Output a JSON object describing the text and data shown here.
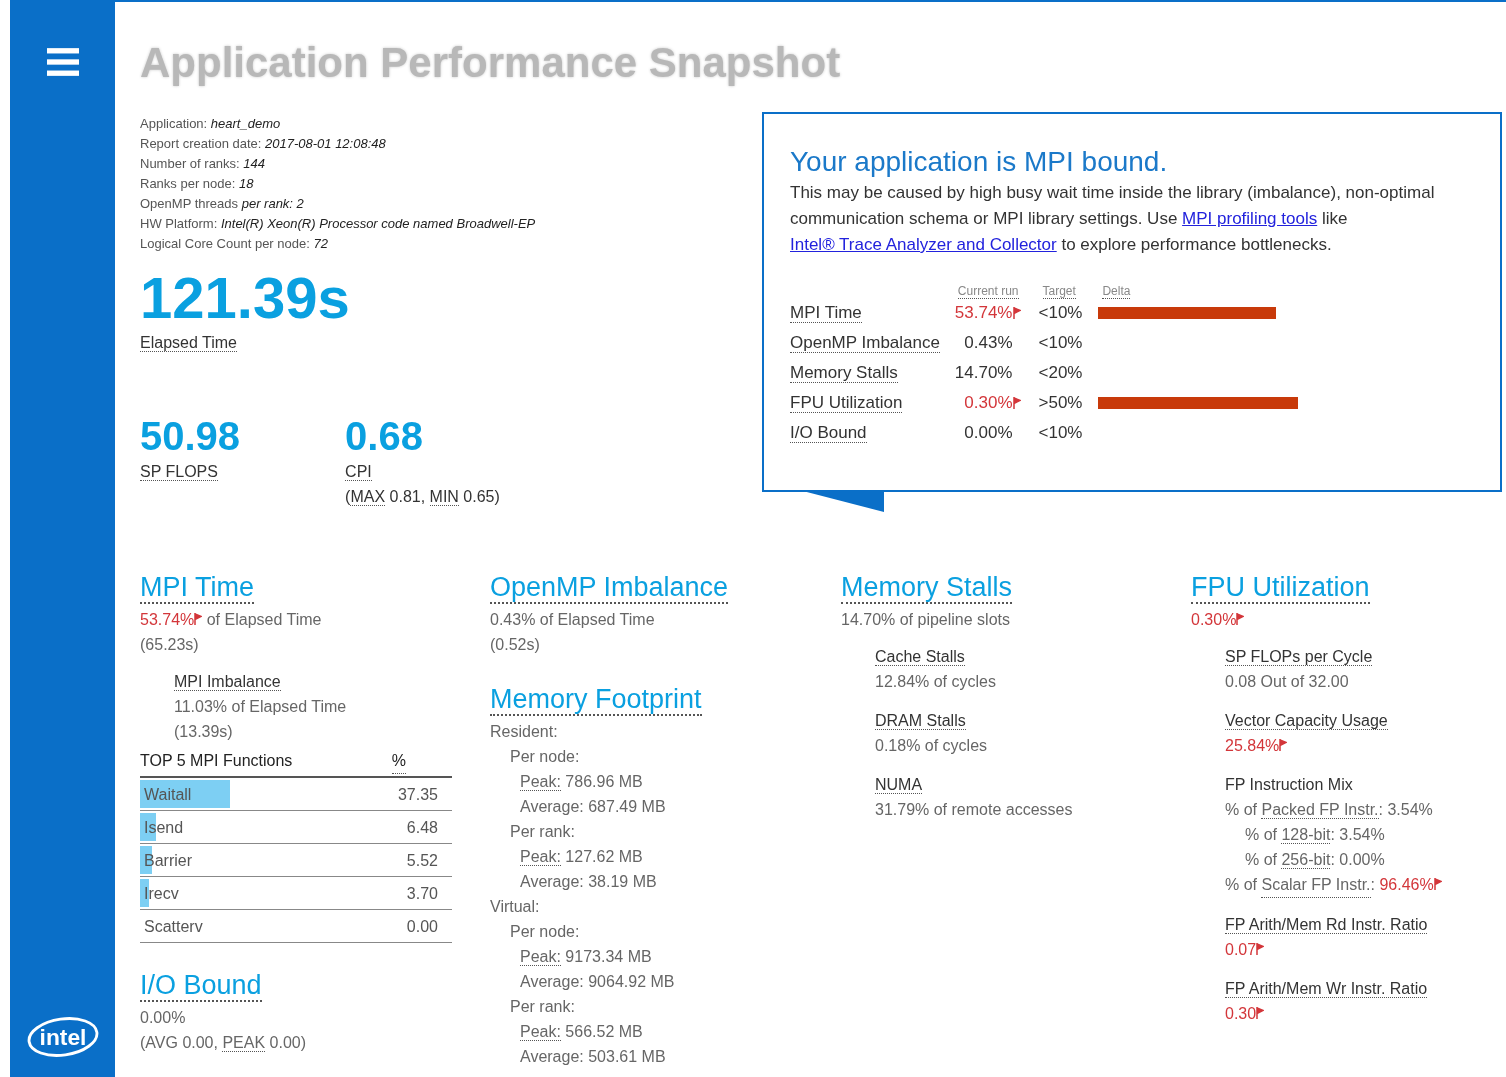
{
  "sidebar": {
    "logo": "intel"
  },
  "title": "Application Performance Snapshot",
  "info": [
    {
      "label": "Application:",
      "value": "heart_demo"
    },
    {
      "label": "Report creation date:",
      "value": "2017-08-01 12:08:48"
    },
    {
      "label": "Number of ranks:",
      "value": "144"
    },
    {
      "label": "Ranks per node:",
      "value": "18"
    },
    {
      "label": "OpenMP threads",
      "value": "per rank: 2"
    },
    {
      "label": "HW Platform:",
      "value": "Intel(R) Xeon(R) Processor code named Broadwell-EP"
    },
    {
      "label": "Logical Core Count per node:",
      "value": "72"
    }
  ],
  "elapsed": {
    "value": "121.39s",
    "label": "Elapsed Time"
  },
  "metrics": [
    {
      "value": "50.98",
      "label": "SP FLOPS"
    },
    {
      "value": "0.68",
      "label": "CPI",
      "detail": [
        {
          "text": "("
        },
        {
          "text": "MAX",
          "term": true
        },
        {
          "text": " 0.81, "
        },
        {
          "text": "MIN",
          "term": true
        },
        {
          "text": " 0.65)"
        }
      ]
    }
  ],
  "callout": {
    "title": "Your application is MPI bound.",
    "body": [
      {
        "text": "This may be caused by high busy wait time inside the library (imbalance), non-optimal communication schema or MPI library settings. Use "
      },
      {
        "text": "MPI profiling tools",
        "link": true
      },
      {
        "text": " like "
      },
      {
        "text": "Intel® Trace Analyzer and Collector",
        "link": true
      },
      {
        "text": " to explore performance bottlenecks."
      }
    ],
    "columns": [
      "Current run",
      "Target",
      "Delta"
    ],
    "rows": [
      {
        "name": "MPI Time",
        "current": "53.74%",
        "flag": true,
        "target": "<10%",
        "level": 0.48
      },
      {
        "name": "OpenMP Imbalance",
        "current": "0.43%",
        "flag": false,
        "target": "<10%"
      },
      {
        "name": "Memory Stalls",
        "current": "14.70%",
        "flag": false,
        "target": "<20%"
      },
      {
        "name": "FPU Utilization",
        "current": "0.30%",
        "flag": true,
        "target": ">50%",
        "level": 0.54
      },
      {
        "name": "I/O Bound",
        "current": "0.00%",
        "flag": false,
        "target": "<10%"
      }
    ]
  },
  "columns": [
    [
      {
        "title": "MPI Time",
        "lines": [
          [
            {
              "text": "53.74%",
              "flag": true
            },
            {
              "text": " of Elapsed Time"
            }
          ],
          "(65.23s)"
        ],
        "subsections": [
          {
            "title": "MPI Imbalance",
            "term": true,
            "lines": [
              "11.03% of Elapsed Time",
              "(13.39s)"
            ]
          }
        ],
        "functions": {
          "columns": [
            "TOP 5 MPI Functions",
            "%"
          ],
          "rows": [
            {
              "name": "Waitall",
              "value": "37.35",
              "level": 0.29
            },
            {
              "name": "Isend",
              "value": "6.48",
              "level": 0.05
            },
            {
              "name": "Barrier",
              "value": "5.52",
              "level": 0.04
            },
            {
              "name": "Irecv",
              "value": "3.70",
              "level": 0.03
            },
            {
              "name": "Scatterv",
              "value": "0.00"
            }
          ]
        }
      },
      {
        "title": "I/O Bound",
        "lines": [
          "0.00%",
          [
            {
              "text": "(AVG 0.00, "
            },
            {
              "text": "PEAK",
              "term": true
            },
            {
              "text": " 0.00)"
            }
          ]
        ]
      }
    ],
    [
      {
        "title": "OpenMP Imbalance",
        "lines": [
          "0.43% of Elapsed Time",
          "(0.52s)"
        ]
      },
      {
        "title": "Memory Footprint",
        "tree": [
          {
            "text": "Resident:",
            "children": [
              {
                "text": "Per node:",
                "children": [
                  {
                    "parts": [
                      {
                        "text": "Peak:",
                        "term": true
                      },
                      {
                        "text": " 786.96 MB"
                      }
                    ]
                  },
                  {
                    "text": "Average: 687.49 MB"
                  }
                ]
              },
              {
                "text": "Per rank:",
                "children": [
                  {
                    "parts": [
                      {
                        "text": "Peak:",
                        "term": true
                      },
                      {
                        "text": " 127.62 MB"
                      }
                    ]
                  },
                  {
                    "text": "Average: 38.19 MB"
                  }
                ]
              }
            ]
          },
          {
            "text": "Virtual:",
            "children": [
              {
                "text": "Per node:",
                "children": [
                  {
                    "parts": [
                      {
                        "text": "Peak:",
                        "term": true
                      },
                      {
                        "text": " 9173.34 MB"
                      }
                    ]
                  },
                  {
                    "text": "Average: 9064.92 MB"
                  }
                ]
              },
              {
                "text": "Per rank:",
                "children": [
                  {
                    "parts": [
                      {
                        "text": "Peak:",
                        "term": true
                      },
                      {
                        "text": " 566.52 MB"
                      }
                    ]
                  },
                  {
                    "text": "Average: 503.61 MB"
                  }
                ]
              }
            ]
          }
        ]
      }
    ],
    [
      {
        "title": "Memory Stalls",
        "lines": [
          "14.70% of pipeline slots"
        ],
        "subsections": [
          {
            "title": "Cache Stalls",
            "term": true,
            "lines": [
              "12.84% of cycles"
            ]
          },
          {
            "title": "DRAM Stalls",
            "term": true,
            "lines": [
              "0.18% of cycles"
            ]
          },
          {
            "title": "NUMA",
            "term": true,
            "lines": [
              "31.79% of remote accesses"
            ]
          }
        ]
      }
    ],
    [
      {
        "title": "FPU Utilization",
        "lines": [
          [
            {
              "text": "0.30%",
              "flag": true
            }
          ]
        ],
        "subsections": [
          {
            "title": "SP FLOPs per Cycle",
            "term": true,
            "lines": [
              "0.08 Out of 32.00"
            ]
          },
          {
            "title": "Vector Capacity Usage",
            "term": true,
            "lines": [
              [
                {
                  "text": "25.84%",
                  "flag": true
                }
              ]
            ]
          },
          {
            "title": "FP Instruction Mix",
            "term": false,
            "tree": [
              {
                "parts": [
                  {
                    "text": "% of "
                  },
                  {
                    "text": "Packed FP Instr.",
                    "term": true
                  },
                  {
                    "text": ": 3.54%"
                  }
                ],
                "children": [
                  {
                    "parts": [
                      {
                        "text": "% of "
                      },
                      {
                        "text": "128-bit",
                        "term": true
                      },
                      {
                        "text": ": 3.54%"
                      }
                    ]
                  },
                  {
                    "parts": [
                      {
                        "text": "% of "
                      },
                      {
                        "text": "256-bit",
                        "term": true
                      },
                      {
                        "text": ": 0.00%"
                      }
                    ]
                  }
                ]
              },
              {
                "parts": [
                  {
                    "text": "% of "
                  },
                  {
                    "text": "Scalar FP Instr.",
                    "term": true
                  },
                  {
                    "text": ": "
                  },
                  {
                    "text": "96.46%",
                    "flag": true
                  }
                ]
              }
            ]
          },
          {
            "title": "FP Arith/Mem Rd Instr. Ratio",
            "term": true,
            "lines": [
              [
                {
                  "text": "0.07",
                  "flag": true
                }
              ]
            ]
          },
          {
            "title": "FP Arith/Mem Wr Instr. Ratio",
            "term": true,
            "lines": [
              [
                {
                  "text": "0.30",
                  "flag": true
                }
              ]
            ]
          }
        ]
      }
    ]
  ]
}
